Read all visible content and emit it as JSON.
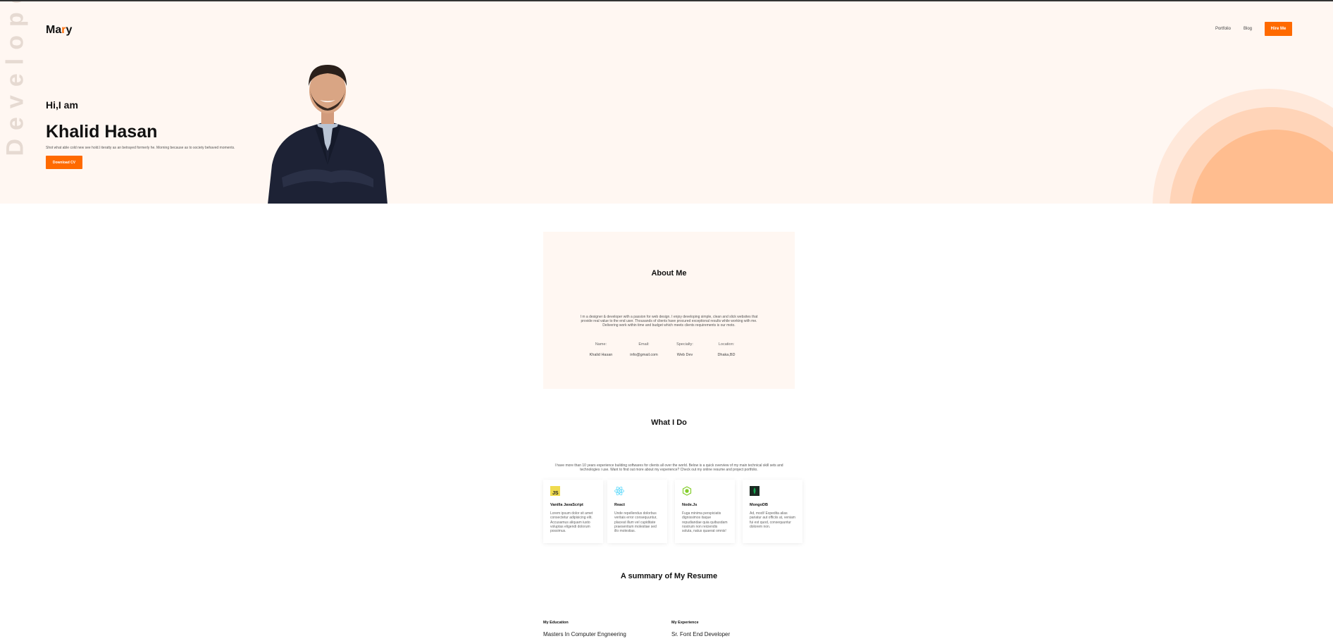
{
  "hero": {
    "vertical_word": "Developer",
    "logo": {
      "prefix": "Ma",
      "accent": "r",
      "suffix": "y"
    },
    "nav": {
      "portfolio": "Portfolio",
      "blog": "Blog",
      "hire": "Hire Me"
    },
    "greeting": "Hi,I am",
    "name": "Khalid Hasan",
    "description": "Shot what able cold new see hold.l iteratty as an betrayed formerly he. Morning because as to society behaved moments.",
    "download_label": "Download CV"
  },
  "about": {
    "title": "About Me",
    "text": "I m a designer & developer with a passion for web design. I enjoy developing simple, clean and slick websites that provide real value to the end user. Thousands of clients have procured exceptional results while working with me. Delivering work within time and budget which meets clients requirements is our moto.",
    "info": [
      {
        "label": "Name:",
        "value": "Khalid Hasan"
      },
      {
        "label": "Email:",
        "value": "info@gmail.com"
      },
      {
        "label": "Specialty:",
        "value": "Web Dev"
      },
      {
        "label": "Location:",
        "value": "Dhaka,BD"
      }
    ]
  },
  "what_i_do": {
    "title": "What I Do",
    "text": "I have more than 10 years experience building softwares for clients all over the world. Below is a quick overview of my main technical skill sets and technologies i use. Want to find out more about my experience? Check out my online resume and project portfolio.",
    "cards": [
      {
        "icon": "javascript-icon",
        "title": "Vanilla JavaScript",
        "desc": "Lorem ipsum dolor sit amet consectetur adipisicing elit. Accusamus aliquam iusto voluptas eligendi dolorum possimus."
      },
      {
        "icon": "react-icon",
        "title": "React",
        "desc": "Unde repellendus dolorbus veritais error consequuntur, placeat illum vel cupiditate praesentium molestiae sed illo molestias."
      },
      {
        "icon": "nodejs-icon",
        "title": "Node.Js",
        "desc": "Fuga minima perspiciatis dignissimos itaque repudiandae quia quibusdam nostrum non reiciendis soluta, natus quaerat omnis!"
      },
      {
        "icon": "mongodb-icon",
        "title": "MongoDB",
        "desc": "Ad, modi! Expedita alias pariatur aut officiis at, veniam fui est quod, consequuntur dolorem non."
      }
    ]
  },
  "resume": {
    "title": "A summary of My Resume",
    "education_heading": "My Education",
    "education_item": "Masters In Computer Engneering",
    "experience_heading": "My Experience",
    "experience_item": "Sr. Font End Developer"
  },
  "colors": {
    "accent": "#ff6a00",
    "hero_bg": "#fff7f2"
  }
}
